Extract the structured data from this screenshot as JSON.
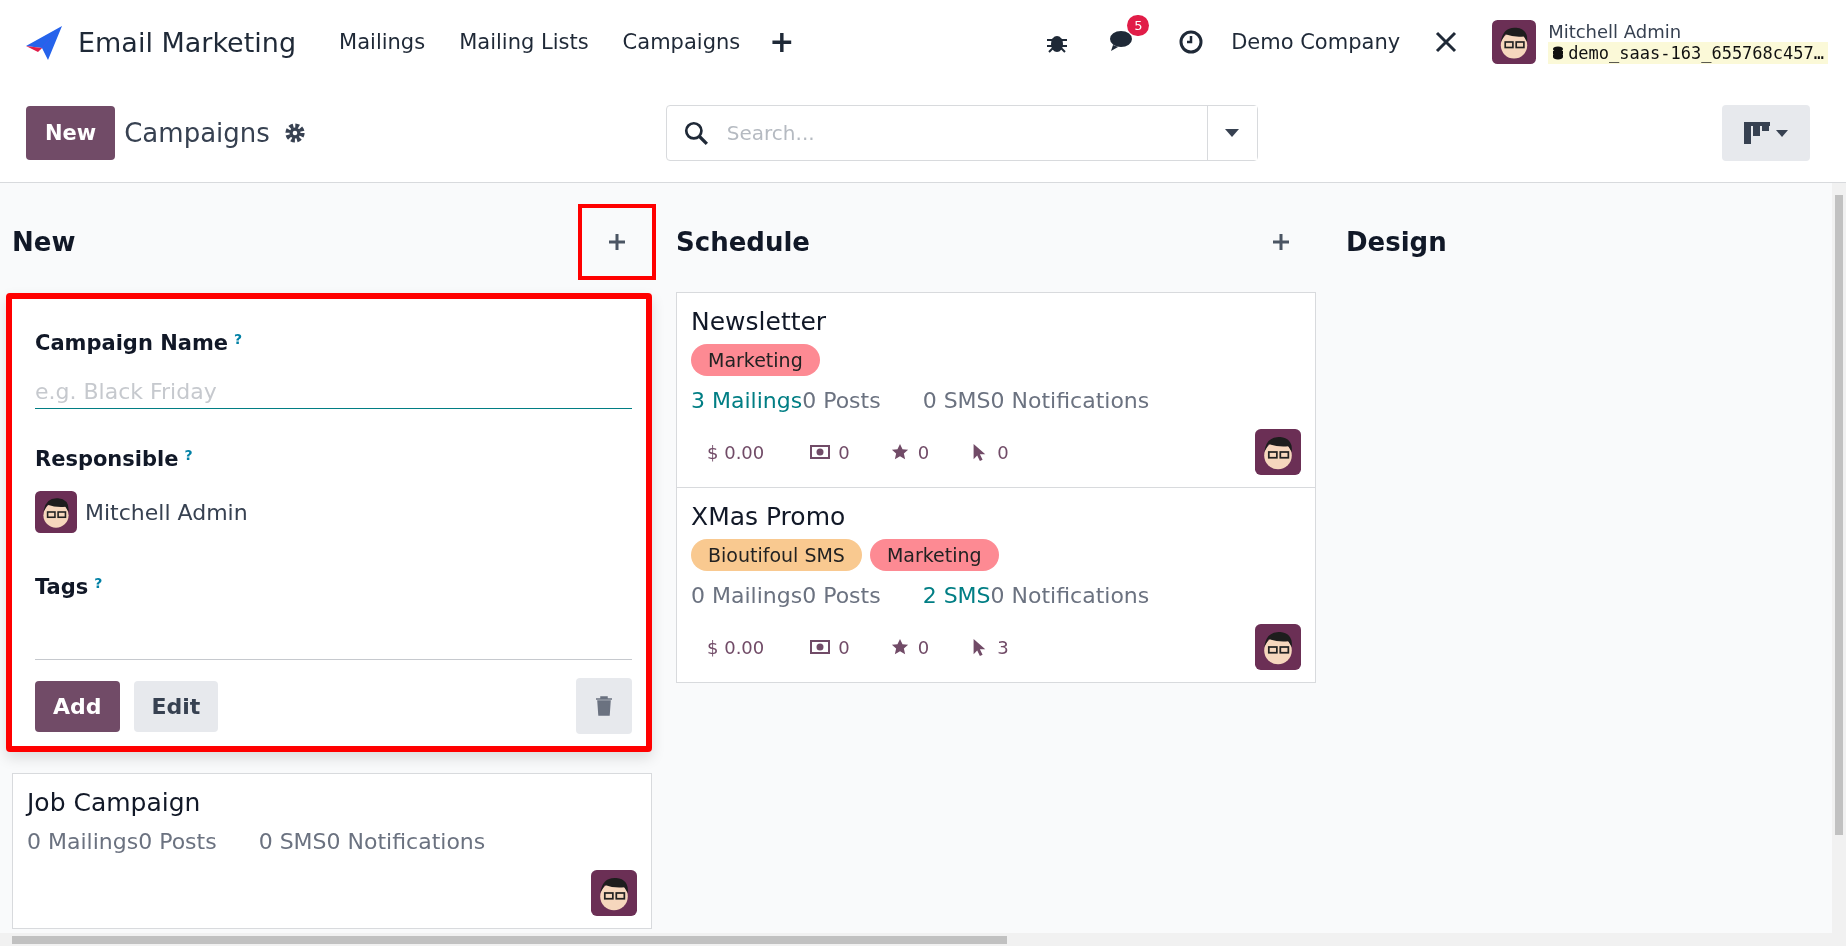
{
  "navbar": {
    "app_name": "Email Marketing",
    "menu": [
      "Mailings",
      "Mailing Lists",
      "Campaigns"
    ],
    "add_icon": "+",
    "messages_badge": "5",
    "company": "Demo Company",
    "user_name": "Mitchell Admin",
    "database": "demo_saas-163_655768c457…"
  },
  "control_panel": {
    "new_button": "New",
    "title": "Campaigns",
    "search_placeholder": "Search..."
  },
  "columns": [
    {
      "title": "New",
      "highlighted_add": true,
      "quick_create": {
        "highlighted": true,
        "name_label": "Campaign Name",
        "help": "?",
        "name_placeholder": "e.g. Black Friday",
        "responsible_label": "Responsible",
        "responsible_help": "?",
        "responsible": "Mitchell Admin",
        "tags_label": "Tags",
        "tags_help": "?",
        "add_button": "Add",
        "edit_button": "Edit"
      },
      "cards": [
        {
          "title": "Job Campaign",
          "stats": [
            [
              {
                "text": "0 Mailings",
                "active": false
              },
              {
                "text": "0 Posts",
                "active": false
              }
            ],
            [
              {
                "text": "0 SMS",
                "active": false
              },
              {
                "text": "0 Notifications",
                "active": false
              }
            ]
          ]
        }
      ]
    },
    {
      "title": "Schedule",
      "highlighted_add": false,
      "cards": [
        {
          "title": "Newsletter",
          "tags": [
            {
              "label": "Marketing",
              "color": "#fd8a93"
            }
          ],
          "stats": [
            [
              {
                "text": "3 Mailings",
                "active": true
              },
              {
                "text": "0 Posts",
                "active": false
              }
            ],
            [
              {
                "text": "0 SMS",
                "active": false
              },
              {
                "text": "0 Notifications",
                "active": false
              }
            ]
          ],
          "revenue": "$ 0.00",
          "metrics": [
            {
              "kind": "money",
              "value": "0"
            },
            {
              "kind": "star",
              "value": "0"
            },
            {
              "kind": "click",
              "value": "0"
            }
          ]
        },
        {
          "title": "XMas Promo",
          "tags": [
            {
              "label": "Bioutifoul SMS",
              "color": "#f9c990"
            },
            {
              "label": "Marketing",
              "color": "#fd8a93"
            }
          ],
          "stats": [
            [
              {
                "text": "0 Mailings",
                "active": false
              },
              {
                "text": "0 Posts",
                "active": false
              }
            ],
            [
              {
                "text": "2 SMS",
                "active": true
              },
              {
                "text": "0 Notifications",
                "active": false
              }
            ]
          ],
          "revenue": "$ 0.00",
          "metrics": [
            {
              "kind": "money",
              "value": "0"
            },
            {
              "kind": "star",
              "value": "0"
            },
            {
              "kind": "click",
              "value": "3"
            }
          ]
        }
      ]
    },
    {
      "title": "Design"
    }
  ]
}
